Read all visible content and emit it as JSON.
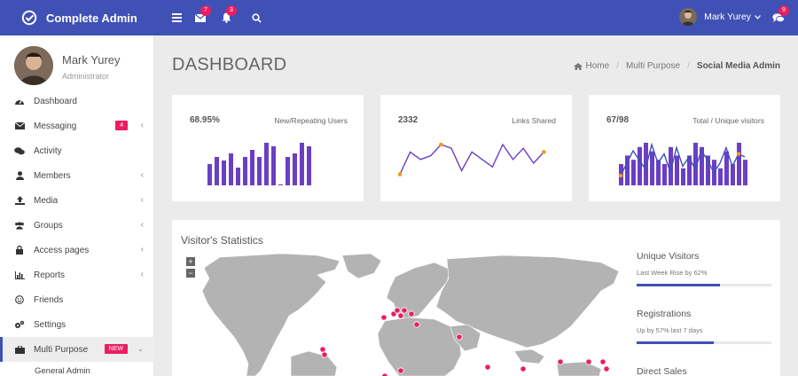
{
  "brand": {
    "title": "Complete Admin",
    "icon": "check-circle-icon"
  },
  "topbar": {
    "mail_badge": "7",
    "bell_badge": "3",
    "chat_badge": "9",
    "user_name": "Mark Yurey"
  },
  "profile": {
    "name": "Mark Yurey",
    "role": "Administrator"
  },
  "sidebar": {
    "items": [
      {
        "label": "Dashboard",
        "icon": "dashboard-icon"
      },
      {
        "label": "Messaging",
        "icon": "envelope-icon",
        "badge": "4"
      },
      {
        "label": "Activity",
        "icon": "comments-icon"
      },
      {
        "label": "Members",
        "icon": "user-icon"
      },
      {
        "label": "Media",
        "icon": "upload-icon"
      },
      {
        "label": "Groups",
        "icon": "users-icon"
      },
      {
        "label": "Access pages",
        "icon": "lock-icon"
      },
      {
        "label": "Reports",
        "icon": "bar-chart-icon"
      },
      {
        "label": "Friends",
        "icon": "smile-icon"
      },
      {
        "label": "Settings",
        "icon": "cogs-icon"
      },
      {
        "label": "Multi Purpose",
        "icon": "briefcase-icon",
        "badge": "NEW"
      }
    ],
    "sub_items": [
      {
        "label": "General Admin"
      }
    ]
  },
  "page": {
    "title": "DASHBOARD"
  },
  "breadcrumb": {
    "home": "Home",
    "section": "Multi Purpose",
    "current": "Social Media Admin"
  },
  "cards": [
    {
      "value": "68.95%",
      "label": "New/Repeating Users"
    },
    {
      "value": "2332",
      "label": "Links Shared"
    },
    {
      "value": "67/98",
      "label": "Total / Unique visitors"
    }
  ],
  "stats": {
    "title": "Visitor's Statistics",
    "zoom_in": "+",
    "zoom_out": "−",
    "metrics": [
      {
        "title": "Unique Visitors",
        "sub": "Last Week Rise by 62%",
        "progress": 0.62
      },
      {
        "title": "Registrations",
        "sub": "Up by 57% last 7 days",
        "progress": 0.57
      },
      {
        "title": "Direct Sales"
      }
    ]
  },
  "colors": {
    "primary": "#3f51b5",
    "accent": "#e91e63",
    "bars": "#6a3fc4",
    "dot": "#f39c12"
  },
  "sparklines": {
    "bars1": [
      6,
      8,
      7,
      9,
      5,
      8,
      10,
      8,
      12,
      11,
      0,
      8,
      9,
      12,
      11
    ],
    "line2": [
      2,
      8,
      6,
      7,
      10,
      9,
      3,
      8,
      6,
      4,
      10,
      6,
      9,
      5,
      8
    ],
    "bars3": [
      5,
      7,
      6,
      9,
      10,
      8,
      6,
      5,
      9,
      7,
      4,
      7,
      10,
      9,
      7,
      6,
      4,
      8,
      5,
      10,
      6
    ],
    "line3": [
      2,
      6,
      10,
      7,
      4,
      12,
      6,
      9,
      3,
      11,
      5,
      8,
      4,
      10,
      7,
      3,
      6,
      11,
      5,
      9,
      8
    ]
  }
}
